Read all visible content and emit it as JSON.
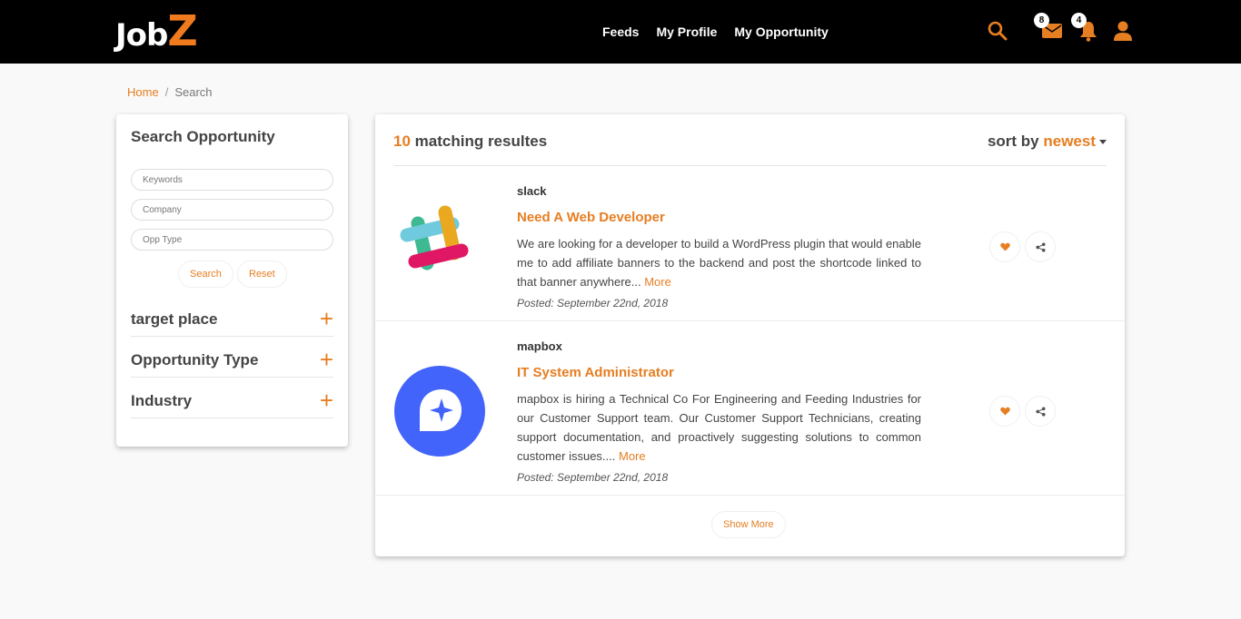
{
  "brand": {
    "logo_prefix": "Job",
    "logo_suffix": "Z",
    "accent": "#e67e22"
  },
  "nav": {
    "feeds": "Feeds",
    "my_profile": "My Profile",
    "my_opportunity": "My Opportunity"
  },
  "icons": {
    "search": "search-icon",
    "messages": "envelope-icon",
    "notifications": "bell-icon",
    "user": "user-icon"
  },
  "badges": {
    "messages": "8",
    "notifications": "4"
  },
  "breadcrumb": {
    "home": "Home",
    "sep": "/",
    "current": "Search"
  },
  "search_panel": {
    "title": "Search Opportunity",
    "keywords_placeholder": "Keywords",
    "company_placeholder": "Company",
    "opp_type_placeholder": "Opp Type",
    "search_label": "Search",
    "reset_label": "Reset",
    "sections": [
      {
        "label": "target place",
        "toggle": "+"
      },
      {
        "label": "Opportunity Type",
        "toggle": "+"
      },
      {
        "label": "Industry",
        "toggle": "+"
      }
    ]
  },
  "results": {
    "count": "10",
    "count_label": "matching resultes",
    "sort_label": "sort by",
    "sort_value": "newest",
    "jobs": [
      {
        "company": "slack",
        "title": "Need A Web Developer",
        "description": "We are looking for a developer to build a WordPress plugin that would enable me to add affiliate banners to the backend and post the shortcode linked to that banner anywhere...",
        "more": "More",
        "posted": "Posted: September 22nd, 2018",
        "logo": "slack-logo"
      },
      {
        "company": "mapbox",
        "title": "IT System Administrator",
        "description": "mapbox is hiring a Technical Co For Engineering and Feeding Industries for our Customer Support team. Our Customer Support Technicians, creating support documentation, and proactively suggesting solutions to common customer issues....",
        "more": "More",
        "posted": "Posted: September 22nd, 2018",
        "logo": "mapbox-logo"
      }
    ],
    "show_more_label": "Show More"
  }
}
